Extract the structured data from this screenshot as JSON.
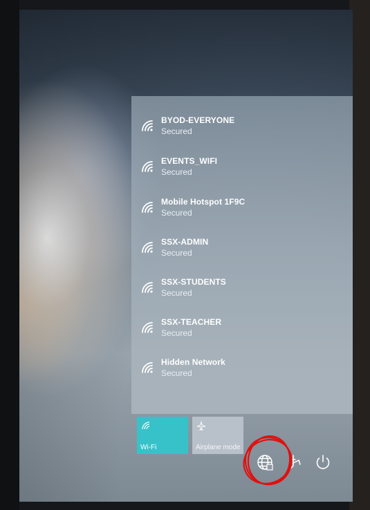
{
  "networks": [
    {
      "name": "BYOD-EVERYONE",
      "status": "Secured"
    },
    {
      "name": "EVENTS_WIFI",
      "status": "Secured"
    },
    {
      "name": "Mobile Hotspot 1F9C",
      "status": "Secured"
    },
    {
      "name": "SSX-ADMIN",
      "status": "Secured"
    },
    {
      "name": "SSX-STUDENTS",
      "status": "Secured"
    },
    {
      "name": "SSX-TEACHER",
      "status": "Secured"
    },
    {
      "name": "Hidden Network",
      "status": "Secured"
    }
  ],
  "quick_actions": {
    "wifi_label": "Wi-Fi",
    "airplane_label": "Airplane mode"
  },
  "colors": {
    "wifi_tile": "#37c2c9",
    "annotation": "#e01010"
  },
  "icons": {
    "network": "wifi-signal-icon",
    "globe": "globe-network-icon",
    "ease": "ease-of-access-icon",
    "power": "power-icon"
  }
}
